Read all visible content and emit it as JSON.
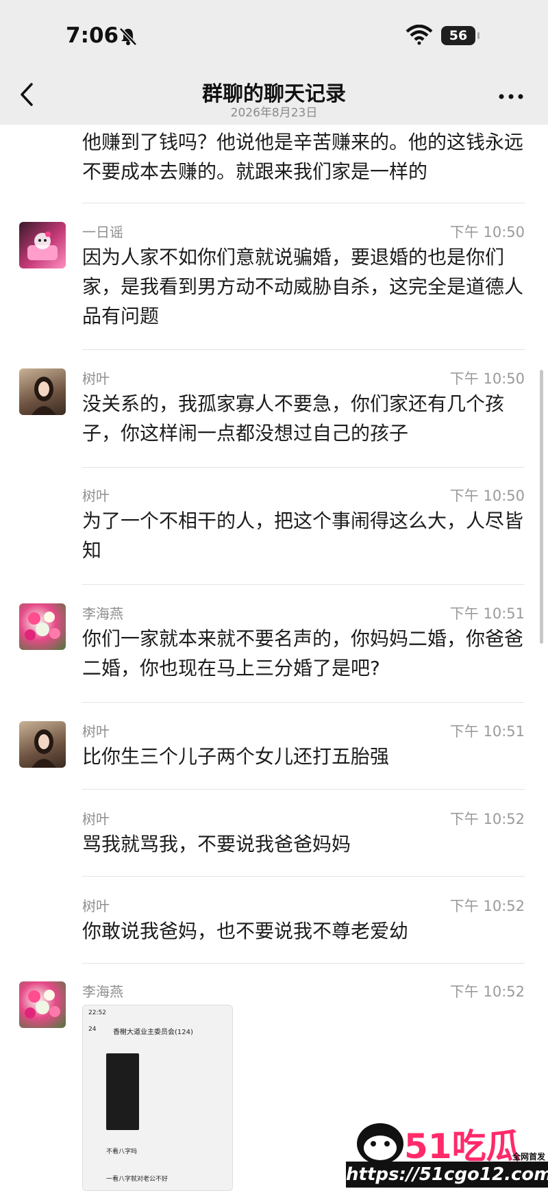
{
  "status": {
    "time": "7:06",
    "battery": "56"
  },
  "nav": {
    "title": "群聊的聊天记录",
    "date": "2026年8月23日"
  },
  "messages": [
    {
      "text": "他赚到了钱吗？他说他是辛苦赚来的。他的这钱永远不要成本去赚的。就跟来我们家是一样的"
    },
    {
      "sender": "一日谣",
      "time": "下午 10:50",
      "text": "因为人家不如你们意就说骗婚，要退婚的也是你们家，是我看到男方动不动威胁自杀，这完全是道德人品有问题"
    },
    {
      "sender": "树叶",
      "time": "下午 10:50",
      "text": "没关系的，我孤家寡人不要急，你们家还有几个孩子，你这样闹一点都没想过自己的孩子"
    },
    {
      "sender": "树叶",
      "time": "下午 10:50",
      "text": "为了一个不相干的人，把这个事闹得这么大，人尽皆知"
    },
    {
      "sender": "李海燕",
      "time": "下午 10:51",
      "text": "你们一家就本来就不要名声的，你妈妈二婚，你爸爸二婚，你也现在马上三分婚了是吧?"
    },
    {
      "sender": "树叶",
      "time": "下午 10:51",
      "text": "比你生三个儿子两个女儿还打五胎强"
    },
    {
      "sender": "树叶",
      "time": "下午 10:52",
      "text": "骂我就骂我，不要说我爸爸妈妈"
    },
    {
      "sender": "树叶",
      "time": "下午 10:52",
      "text": "你敢说我爸妈，也不要说我不尊老爱幼"
    },
    {
      "sender": "李海燕",
      "time": "下午 10:52"
    }
  ],
  "shared_image": {
    "time": "22:52",
    "back_count": "24",
    "group": "香榭大道业主委员会(124)",
    "msg1": "不看八字吗",
    "msg2": "一看八字就对老公不好"
  },
  "watermark": {
    "brand": "51吃瓜",
    "url": "https://51cgo12.com",
    "tag": "全网首发"
  }
}
